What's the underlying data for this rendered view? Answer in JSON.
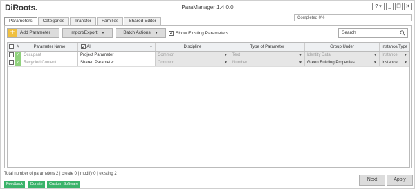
{
  "app": {
    "logo": "DiRoots.",
    "title": "ParaManager 1.4.0.0",
    "help_label": "?",
    "progress_text": "Completed 0%",
    "progress_value": 0
  },
  "tabs": [
    {
      "label": "Parameters",
      "active": true
    },
    {
      "label": "Categories"
    },
    {
      "label": "Transfer"
    },
    {
      "label": "Families"
    },
    {
      "label": "Shared Editor"
    }
  ],
  "toolbar": {
    "add_label": "Add Parameter",
    "import_export_label": "Import/Export",
    "batch_label": "Batch Actions",
    "show_existing_label": "Show Existing Parameters",
    "show_existing_checked": true,
    "search_placeholder": "Search"
  },
  "grid": {
    "columns": [
      "Parameter Name",
      "All",
      "Discipline",
      "Type of Parameter",
      "Group Under",
      "Instance/Type"
    ],
    "rows": [
      {
        "name": "Occupant",
        "kind": "Project Parameter",
        "discipline": "Common",
        "type": "Text",
        "group": "Identity Data",
        "instance": "Instance",
        "muted": true
      },
      {
        "name": "Recycled Content",
        "kind": "Shared Parameter",
        "discipline": "Common",
        "type": "Number",
        "group": "Green Building Properties",
        "instance": "Instance",
        "muted": false
      }
    ]
  },
  "footer": {
    "status": "Total number of parameters 2 | create 0 | modify 0 | existing 2",
    "feedback": "Feedback",
    "donate": "Donate",
    "custom": "Custom Software",
    "next": "Next",
    "apply": "Apply"
  },
  "colors": {
    "accent_green": "#3ab36a",
    "check_green": "#8fd17c",
    "add_yellow": "#f0c040"
  }
}
